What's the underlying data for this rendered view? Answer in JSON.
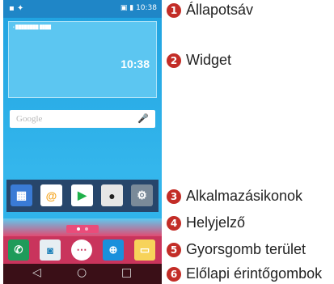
{
  "status_bar": {
    "time": "10:38",
    "left_icons": "▪ ✦",
    "right_icons": "▣ ▮"
  },
  "widget": {
    "time": "10:38",
    "small_text": "▪ ████████ ████"
  },
  "search": {
    "placeholder": "Google",
    "mic_glyph": "🎤"
  },
  "apps": [
    {
      "name": "calendar-app",
      "glyph": "▦"
    },
    {
      "name": "email-app",
      "glyph": "@"
    },
    {
      "name": "play-store-app",
      "glyph": "▶"
    },
    {
      "name": "camera-app",
      "glyph": "●"
    },
    {
      "name": "settings-app",
      "glyph": "⚙"
    }
  ],
  "dock": [
    {
      "name": "phone-app",
      "glyph": "✆"
    },
    {
      "name": "contacts-app",
      "glyph": "◙"
    },
    {
      "name": "app-drawer",
      "glyph": "⋯"
    },
    {
      "name": "browser-app",
      "glyph": "⊕"
    },
    {
      "name": "messages-app",
      "glyph": "▭"
    }
  ],
  "navbar": {
    "back": "◁",
    "home": "○",
    "recent": "□"
  },
  "callouts": [
    {
      "number": "1",
      "text": "Állapotsáv"
    },
    {
      "number": "2",
      "text": "Widget"
    },
    {
      "number": "3",
      "text": "Alkalmazásikonok"
    },
    {
      "number": "4",
      "text": "Helyjelző"
    },
    {
      "number": "5",
      "text": "Gyorsgomb terület"
    },
    {
      "number": "6",
      "text": "Előlapi érintőgombok"
    }
  ]
}
